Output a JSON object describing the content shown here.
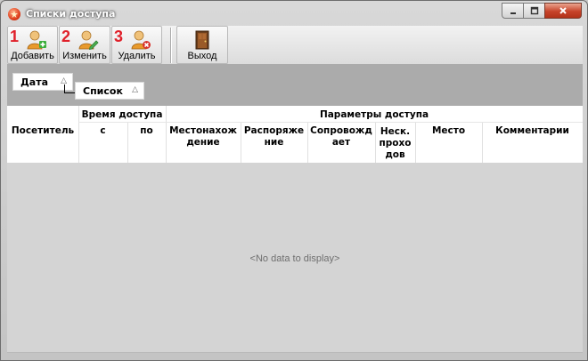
{
  "window": {
    "title": "Списки доступа"
  },
  "toolbar": {
    "add": {
      "number": "1",
      "label": "Добавить",
      "icon": "user-add-icon"
    },
    "edit": {
      "number": "2",
      "label": "Изменить",
      "icon": "user-edit-icon"
    },
    "delete": {
      "number": "3",
      "label": "Удалить",
      "icon": "user-delete-icon"
    },
    "exit": {
      "label": "Выход",
      "icon": "door-exit-icon"
    }
  },
  "grouping": {
    "level1": {
      "label": "Дата",
      "sort": "△"
    },
    "level2": {
      "label": "Список",
      "sort": "△"
    }
  },
  "grid": {
    "band_time": "Время доступа",
    "band_params": "Параметры доступа",
    "columns": {
      "visitor": "Посетитель",
      "from": "с",
      "to": "по",
      "location": "Местонахож дение",
      "order": "Распоряже ние",
      "escort": "Сопровожд ает",
      "multi": "Неск. прохо дов",
      "place": "Место",
      "comments": "Комментарии"
    },
    "empty_text": "<No data to display>"
  },
  "colors": {
    "accent_number": "#e0202a",
    "title_text": "#ffffff",
    "group_bar": "#ababab"
  }
}
